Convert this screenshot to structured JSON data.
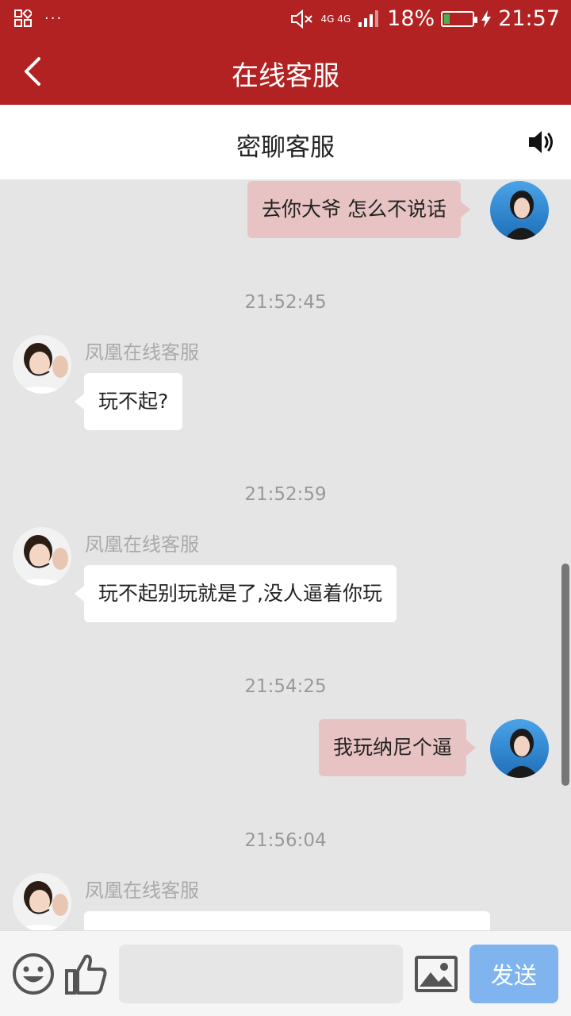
{
  "status_bar": {
    "network_small": "4G 4G",
    "battery_percent": "18%",
    "battery_level": 0.18,
    "time": "21:57",
    "colors": {
      "bar": "#b22222",
      "battery_fill": "#4caf50"
    }
  },
  "header": {
    "title": "在线客服",
    "back_icon": "chevron-left-icon"
  },
  "sub_header": {
    "title": "密聊客服",
    "speaker_icon": "speaker-icon"
  },
  "messages": [
    {
      "type": "out",
      "text": "去你大爷 怎么不说话"
    },
    {
      "type": "time",
      "text": "21:52:45"
    },
    {
      "type": "in",
      "sender": "凤凰在线客服",
      "text": "玩不起?"
    },
    {
      "type": "time",
      "text": "21:52:59"
    },
    {
      "type": "in",
      "sender": "凤凰在线客服",
      "text": "玩不起别玩就是了,没人逼着你玩"
    },
    {
      "type": "time",
      "text": "21:54:25"
    },
    {
      "type": "out",
      "text": "我玩纳尼个逼"
    },
    {
      "type": "time",
      "text": "21:56:04"
    },
    {
      "type": "in",
      "sender": "凤凰在线客服",
      "text": ""
    }
  ],
  "input_bar": {
    "emoji_icon": "emoji-icon",
    "like_icon": "thumbs-up-icon",
    "image_icon": "image-icon",
    "input_value": "",
    "send_label": "发送",
    "colors": {
      "send": "#7fb4ef"
    }
  },
  "colors": {
    "chat_bg": "#e5e5e5",
    "bubble_out": "#e8c3c3",
    "bubble_in": "#ffffff"
  }
}
